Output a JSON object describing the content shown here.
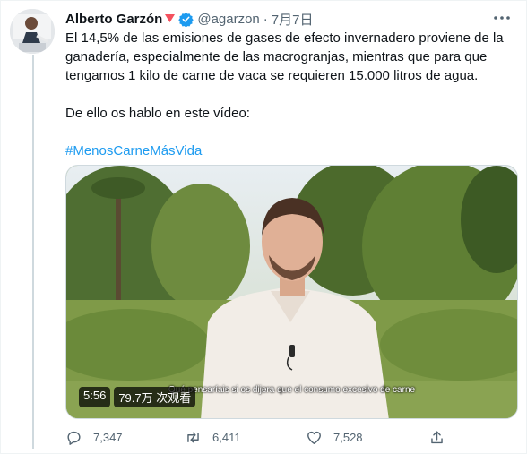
{
  "tweet": {
    "author": {
      "name": "Alberto Garzón",
      "handle": "@agarzon",
      "separator": "·",
      "date": "7月7日"
    },
    "lines": [
      "El 14,5% de las emisiones de gases de efecto invernadero proviene de la",
      "ganadería, especialmente de las macrogranjas, mientras que para que",
      "tengamos 1 kilo de carne de vaca se requieren 15.000 litros de agua."
    ],
    "line2": "De ello os hablo en este vídeo:",
    "hashtag": "#MenosCarneMásVida",
    "video": {
      "duration": "5:56",
      "views": "79.7万 次观看",
      "subtitle": "Qué pensaríais si os dijera que el consumo excesivo de carne"
    },
    "stats": {
      "replies": "7,347",
      "retweets": "6,411",
      "likes": "7,528"
    }
  },
  "colors": {
    "accent": "#1d9bf0",
    "muted": "#536471",
    "triangle": "#f4515e"
  }
}
